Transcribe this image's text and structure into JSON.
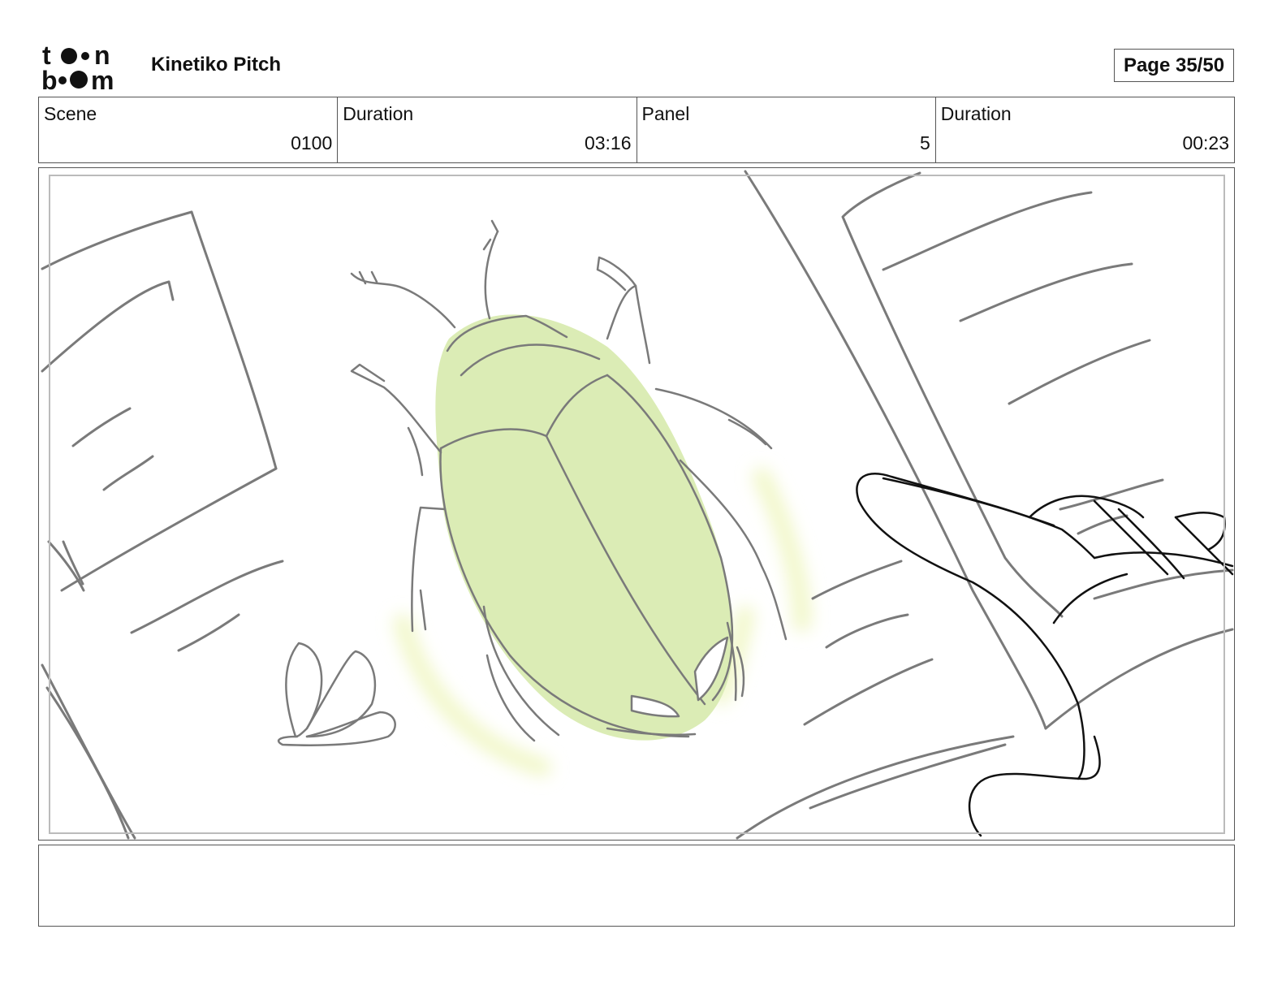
{
  "header": {
    "logo_text": "toon boom",
    "project_title": "Kinetiko Pitch",
    "page_label": "Page 35/50"
  },
  "info": {
    "scene_label": "Scene",
    "scene_value": "0100",
    "scene_duration_label": "Duration",
    "scene_duration_value": "03:16",
    "panel_label": "Panel",
    "panel_value": "5",
    "panel_duration_label": "Duration",
    "panel_duration_value": "00:23"
  },
  "panel": {
    "colors": {
      "sketch": "#7a7a7a",
      "hand": "#111111",
      "beetle_fill": "#dbecb5",
      "glow": "#f1f7c8"
    }
  },
  "dialogue": {
    "text": ""
  }
}
